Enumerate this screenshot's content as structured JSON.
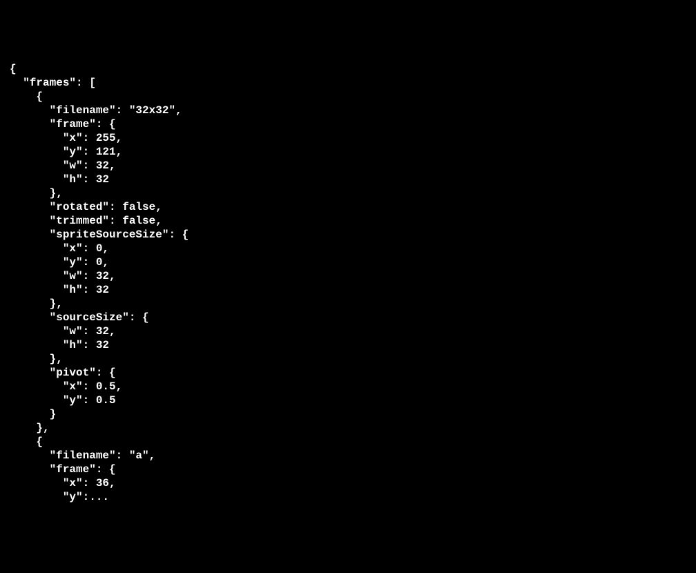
{
  "lines": {
    "l0": "{",
    "l1": "  \"frames\": [",
    "l2": "    {",
    "l3": "      \"filename\": \"32x32\",",
    "l4": "      \"frame\": {",
    "l5": "        \"x\": 255,",
    "l6": "        \"y\": 121,",
    "l7": "        \"w\": 32,",
    "l8": "        \"h\": 32",
    "l9": "      },",
    "l10": "      \"rotated\": false,",
    "l11": "      \"trimmed\": false,",
    "l12": "      \"spriteSourceSize\": {",
    "l13": "        \"x\": 0,",
    "l14": "        \"y\": 0,",
    "l15": "        \"w\": 32,",
    "l16": "        \"h\": 32",
    "l17": "      },",
    "l18": "      \"sourceSize\": {",
    "l19": "        \"w\": 32,",
    "l20": "        \"h\": 32",
    "l21": "      },",
    "l22": "      \"pivot\": {",
    "l23": "        \"x\": 0.5,",
    "l24": "        \"y\": 0.5",
    "l25": "      }",
    "l26": "    },",
    "l27": "    {",
    "l28": "      \"filename\": \"a\",",
    "l29": "      \"frame\": {",
    "l30": "        \"x\": 36,",
    "l31": "        \"y\":..."
  }
}
